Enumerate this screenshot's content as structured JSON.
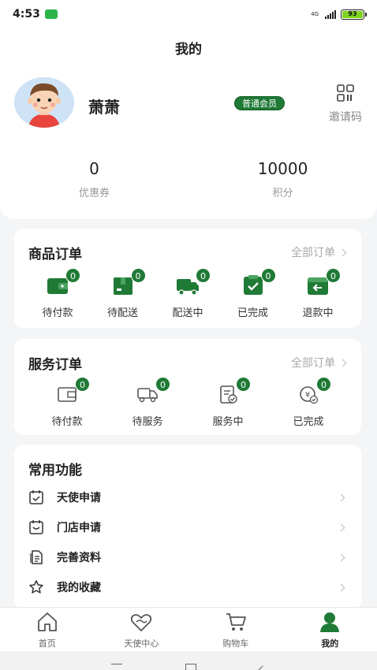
{
  "status_bar": {
    "time": "4:53",
    "network": "4G",
    "battery": "93"
  },
  "header": {
    "title": "我的"
  },
  "profile": {
    "username": "萧萧",
    "member_level": "普通会员",
    "invite_label": "邀请码",
    "stats": [
      {
        "value": "0",
        "label": "优惠券"
      },
      {
        "value": "10000",
        "label": "积分"
      }
    ]
  },
  "product_orders": {
    "title": "商品订单",
    "more_label": "全部订单",
    "items": [
      {
        "icon": "wallet-icon",
        "label": "待付款",
        "count": "0"
      },
      {
        "icon": "package-icon",
        "label": "待配送",
        "count": "0"
      },
      {
        "icon": "truck-icon",
        "label": "配送中",
        "count": "0"
      },
      {
        "icon": "check-box-icon",
        "label": "已完成",
        "count": "0"
      },
      {
        "icon": "return-icon",
        "label": "退款中",
        "count": "0"
      }
    ]
  },
  "service_orders": {
    "title": "服务订单",
    "more_label": "全部订单",
    "items": [
      {
        "icon": "wallet-outline-icon",
        "label": "待付款",
        "count": "0"
      },
      {
        "icon": "service-truck-icon",
        "label": "待服务",
        "count": "0"
      },
      {
        "icon": "clipboard-check-icon",
        "label": "服务中",
        "count": "0"
      },
      {
        "icon": "yen-check-icon",
        "label": "已完成",
        "count": "0"
      }
    ]
  },
  "functions": {
    "title": "常用功能",
    "items": [
      {
        "icon": "calendar-check-icon",
        "label": "天使申请"
      },
      {
        "icon": "calendar-store-icon",
        "label": "门店申请"
      },
      {
        "icon": "document-icon",
        "label": "完善资料"
      },
      {
        "icon": "star-icon",
        "label": "我的收藏"
      }
    ]
  },
  "tabbar": {
    "items": [
      {
        "icon": "home-icon",
        "label": "首页"
      },
      {
        "icon": "heart-hands-icon",
        "label": "天使中心"
      },
      {
        "icon": "cart-icon",
        "label": "购物车"
      },
      {
        "icon": "user-icon",
        "label": "我的"
      }
    ]
  },
  "colors": {
    "accent": "#1f7a36",
    "background": "#f4f5f7"
  }
}
